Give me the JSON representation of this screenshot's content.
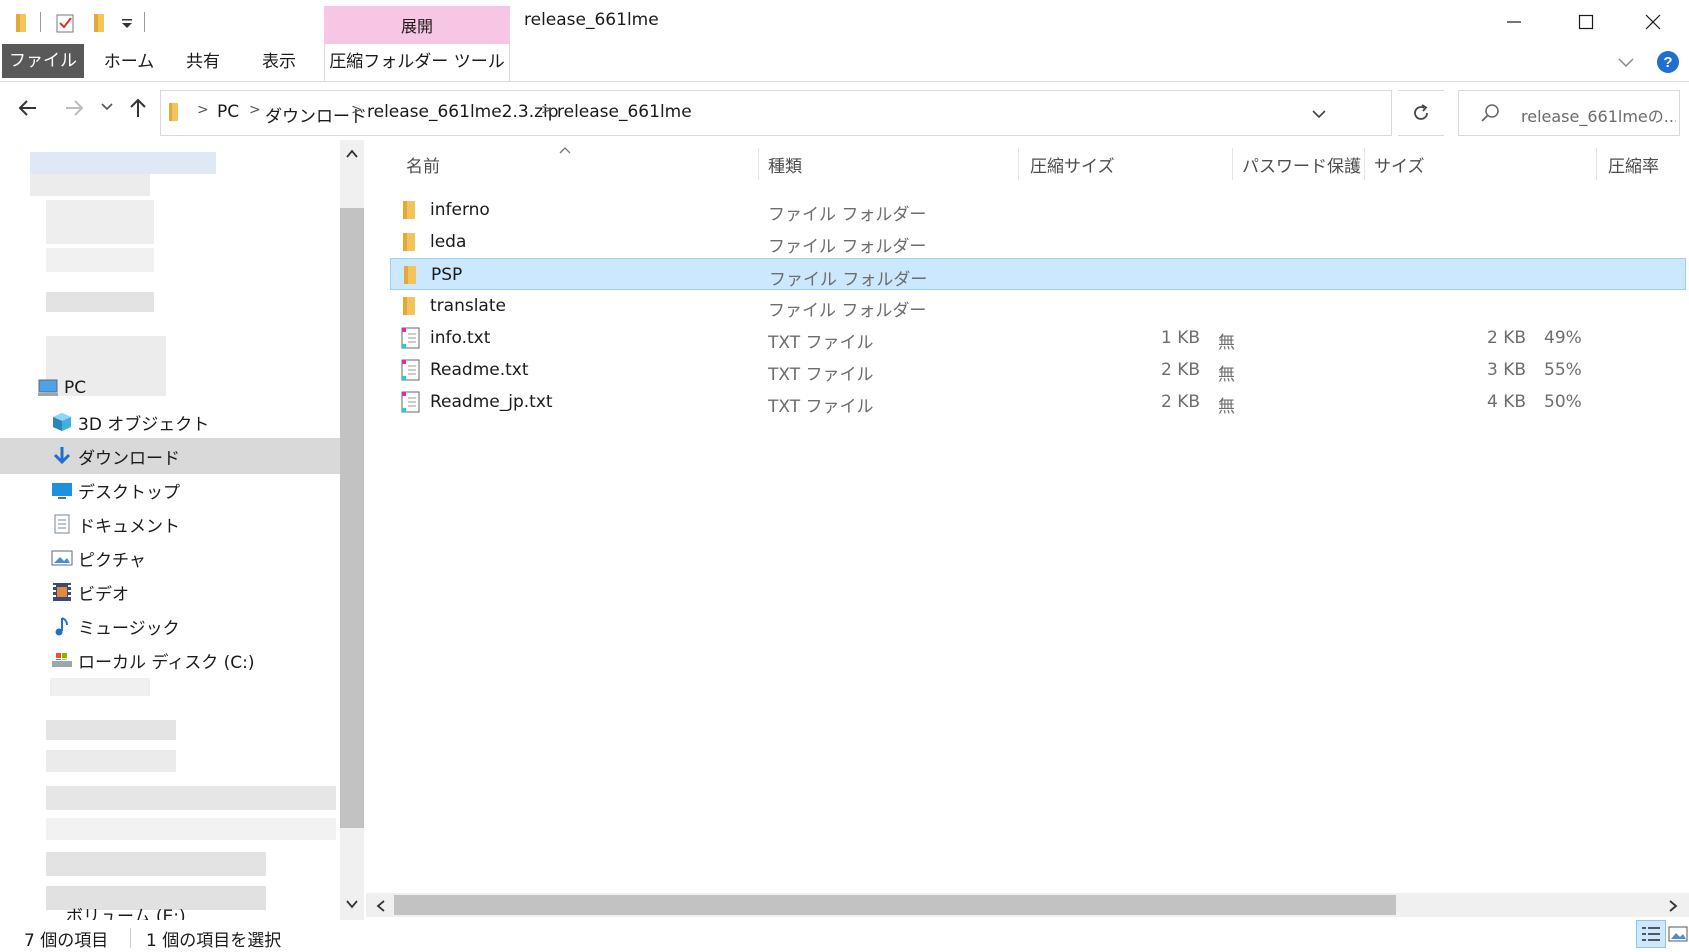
{
  "window": {
    "title": "release_661lme",
    "context_tab_group": "展開"
  },
  "ribbon": {
    "tabs": [
      "ファイル",
      "ホーム",
      "共有",
      "表示",
      "圧縮フォルダー ツール"
    ]
  },
  "address": {
    "crumbs": [
      "PC",
      "ダウンロード",
      "release_661lme2.3.zip",
      "release_661lme"
    ],
    "search_placeholder": "release_661lmeの..."
  },
  "navpane": {
    "items": [
      {
        "label": "PC",
        "icon": "pc-icon"
      },
      {
        "label": "3D オブジェクト",
        "icon": "3d-objects-icon"
      },
      {
        "label": "ダウンロード",
        "icon": "download-icon",
        "selected": true
      },
      {
        "label": "デスクトップ",
        "icon": "desktop-icon"
      },
      {
        "label": "ドキュメント",
        "icon": "document-icon"
      },
      {
        "label": "ピクチャ",
        "icon": "pictures-icon"
      },
      {
        "label": "ビデオ",
        "icon": "video-icon"
      },
      {
        "label": "ミュージック",
        "icon": "music-icon"
      },
      {
        "label": "ローカル ディスク (C:)",
        "icon": "drive-icon"
      }
    ],
    "partial_item": "ボリューム (E:)"
  },
  "columns": {
    "name": "名前",
    "type": "種類",
    "packed": "圧縮サイズ",
    "password": "パスワード保護",
    "size": "サイズ",
    "ratio": "圧縮率"
  },
  "files": [
    {
      "name": "inferno",
      "type": "ファイル フォルダー",
      "packed": "",
      "password": "",
      "size": "",
      "ratio": "",
      "kind": "folder"
    },
    {
      "name": "leda",
      "type": "ファイル フォルダー",
      "packed": "",
      "password": "",
      "size": "",
      "ratio": "",
      "kind": "folder"
    },
    {
      "name": "PSP",
      "type": "ファイル フォルダー",
      "packed": "",
      "password": "",
      "size": "",
      "ratio": "",
      "kind": "folder",
      "selected": true
    },
    {
      "name": "translate",
      "type": "ファイル フォルダー",
      "packed": "",
      "password": "",
      "size": "",
      "ratio": "",
      "kind": "folder"
    },
    {
      "name": "info.txt",
      "type": "TXT ファイル",
      "packed": "1 KB",
      "password": "無",
      "size": "2 KB",
      "ratio": "49%",
      "kind": "txt"
    },
    {
      "name": "Readme.txt",
      "type": "TXT ファイル",
      "packed": "2 KB",
      "password": "無",
      "size": "3 KB",
      "ratio": "55%",
      "kind": "txt"
    },
    {
      "name": "Readme_jp.txt",
      "type": "TXT ファイル",
      "packed": "2 KB",
      "password": "無",
      "size": "4 KB",
      "ratio": "50%",
      "kind": "txt"
    }
  ],
  "status": {
    "count": "7 個の項目",
    "selected": "1 個の項目を選択"
  },
  "colors": {
    "accent": "#0078d7",
    "selection": "#cce8ff",
    "context_tab": "#f7c6e4",
    "folder": "#f2c45a"
  }
}
